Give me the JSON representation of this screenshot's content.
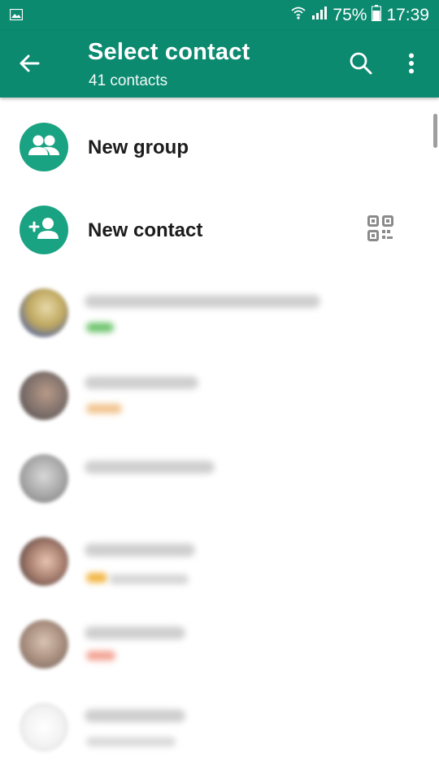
{
  "status_bar": {
    "battery": "75%",
    "time": "17:39",
    "icons": [
      "image-icon",
      "wifi-icon",
      "signal-icon",
      "battery-icon"
    ]
  },
  "header": {
    "title": "Select contact",
    "subtitle": "41 contacts",
    "icons": [
      "back-arrow-icon",
      "search-icon",
      "more-vert-icon"
    ]
  },
  "actions": [
    {
      "label": "New group",
      "icon": "group-icon"
    },
    {
      "label": "New contact",
      "icon": "person-add-icon",
      "trailing_icon": "qr-code-icon"
    }
  ],
  "colors": {
    "primary": "#0b8a70",
    "accent": "#1aa382",
    "text": "#1c1c1c"
  }
}
